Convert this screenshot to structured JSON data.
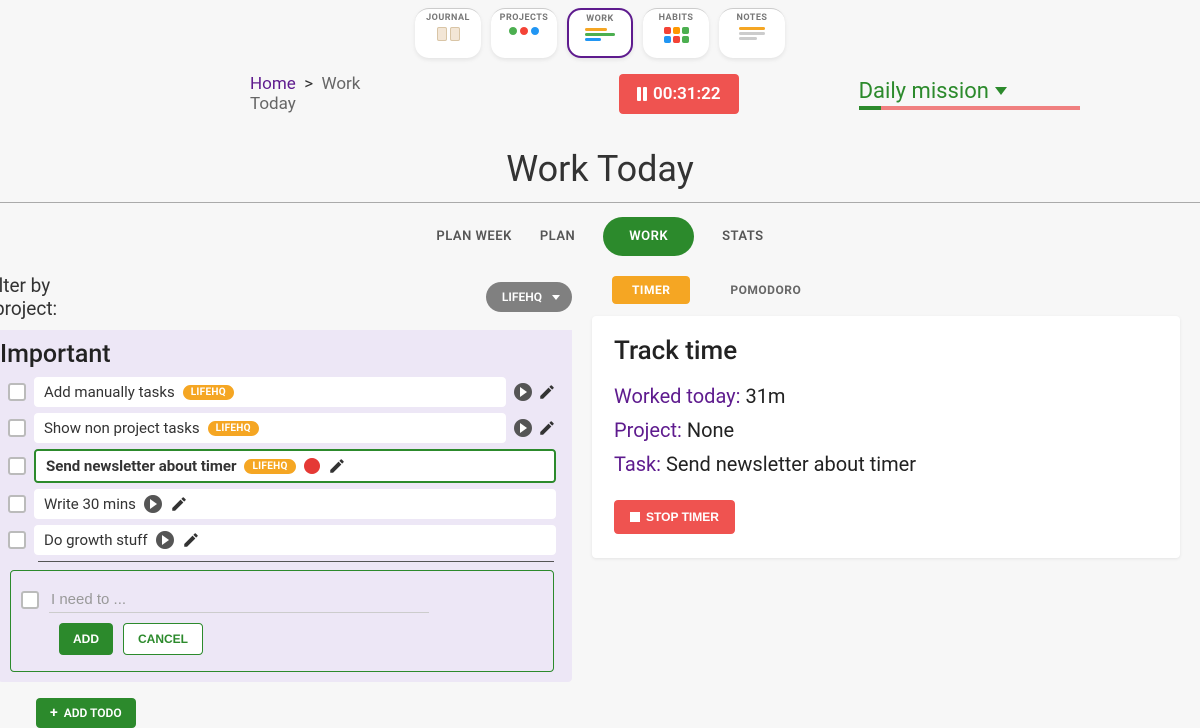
{
  "nav": {
    "items": [
      "JOURNAL",
      "PROJECTS",
      "WORK",
      "HABITS",
      "NOTES"
    ],
    "active": 2
  },
  "breadcrumb": {
    "home": "Home",
    "sep": ">",
    "current": "Work Today"
  },
  "timer": "00:31:22",
  "daily_mission_label": "Daily mission",
  "page_title": "Work Today",
  "tabs": {
    "items": [
      "PLAN WEEK",
      "PLAN",
      "WORK",
      "STATS"
    ],
    "active": 2
  },
  "filter": {
    "label": "ilter by project:",
    "chip": "LIFEHQ"
  },
  "section_title": "Important",
  "tasks": [
    {
      "title": "Add manually tasks",
      "tag": "LIFEHQ",
      "show_tag": true,
      "active": false,
      "recording": false,
      "icons_inside": false
    },
    {
      "title": "Show non project tasks",
      "tag": "LIFEHQ",
      "show_tag": true,
      "active": false,
      "recording": false,
      "icons_inside": false
    },
    {
      "title": "Send newsletter about timer",
      "tag": "LIFEHQ",
      "show_tag": true,
      "active": true,
      "recording": true,
      "icons_inside": true
    },
    {
      "title": "Write 30 mins",
      "tag": "",
      "show_tag": false,
      "active": false,
      "recording": false,
      "icons_inside": true
    },
    {
      "title": "Do growth stuff",
      "tag": "",
      "show_tag": false,
      "active": false,
      "recording": false,
      "icons_inside": true
    }
  ],
  "new_task": {
    "placeholder": "I need to ...",
    "add": "ADD",
    "cancel": "CANCEL"
  },
  "add_todo": "ADD TODO",
  "mode_tabs": {
    "items": [
      "TIMER",
      "POMODORO"
    ],
    "active": 0
  },
  "track": {
    "title": "Track time",
    "worked_label": "Worked today:",
    "worked_value": "31m",
    "project_label": "Project:",
    "project_value": "None",
    "task_label": "Task:",
    "task_value": "Send newsletter about timer",
    "stop": "STOP TIMER"
  },
  "colors": {
    "purple": "#5e1b8e",
    "green": "#2c8a2c",
    "red": "#ef5350",
    "orange": "#f5a623"
  }
}
